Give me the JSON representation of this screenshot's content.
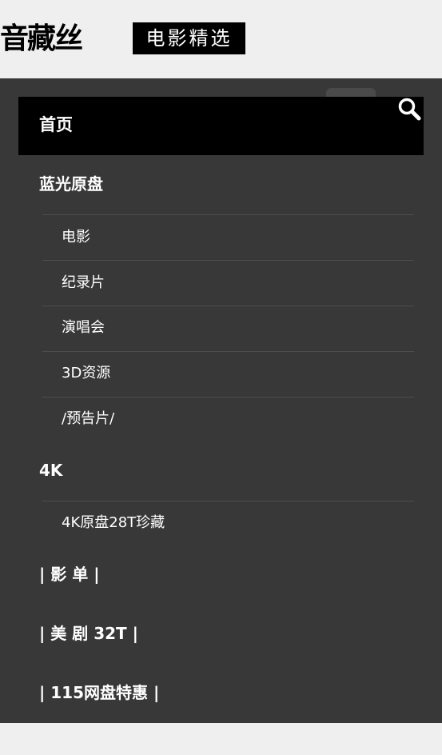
{
  "header": {
    "logo_main": "音藏丝",
    "logo_sub": "电影精选"
  },
  "nav": {
    "home_label": "首页",
    "search_icon": "search-icon",
    "categories": [
      {
        "label": "蓝光原盘",
        "items": [
          "电影",
          "纪录片",
          "演唱会",
          "3D资源",
          "/预告片/"
        ]
      },
      {
        "label": "4K",
        "items": [
          "4K原盘28T珍藏"
        ]
      },
      {
        "label": "| 影 单 |"
      },
      {
        "label": "| 美 剧 32T |"
      },
      {
        "label": "| 115网盘特惠 |"
      }
    ]
  },
  "colors": {
    "page_bg": "#efefef",
    "menu_bg": "#383838",
    "active_bg": "#000000",
    "text": "#ffffff",
    "divider": "#4d4d4d"
  }
}
